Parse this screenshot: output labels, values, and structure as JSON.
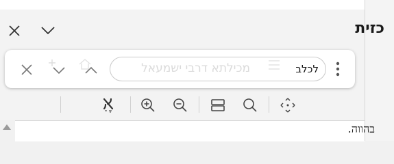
{
  "panel": {
    "title": "כזית",
    "close_icon": "close-icon",
    "collapse_icon": "chevron-down-icon"
  },
  "find_bar": {
    "query": "לכלב",
    "ghost_text": "מכילתא דרבי ישמעאל",
    "buttons": [
      "more-options",
      "previous",
      "next",
      "close"
    ]
  },
  "toolbar": {
    "icons": [
      "move-icon",
      "search-icon",
      "layout-split-icon",
      "zoom-out-icon",
      "zoom-in-icon",
      "hebrew-font-icon"
    ]
  },
  "content": {
    "text": "בהווה."
  },
  "colors": {
    "panel_bg": "#f3f3f3",
    "find_bar_bg": "#ffffff",
    "text": "#1a1a1a",
    "icon": "#555555"
  }
}
